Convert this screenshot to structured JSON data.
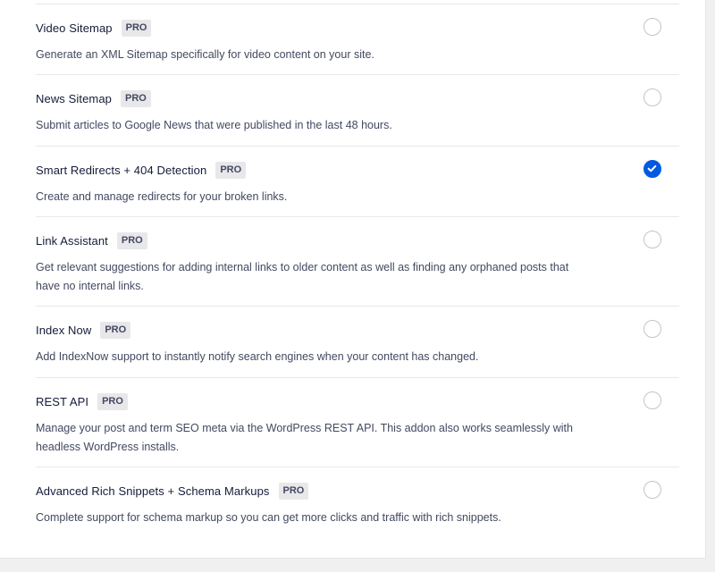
{
  "addons": [
    {
      "name": "Video Sitemap",
      "badge": "PRO",
      "description": "Generate an XML Sitemap specifically for video content on your site.",
      "enabled": false
    },
    {
      "name": "News Sitemap",
      "badge": "PRO",
      "description": "Submit articles to Google News that were published in the last 48 hours.",
      "enabled": false
    },
    {
      "name": "Smart Redirects + 404 Detection",
      "badge": "PRO",
      "description": "Create and manage redirects for your broken links.",
      "enabled": true
    },
    {
      "name": "Link Assistant",
      "badge": "PRO",
      "description": "Get relevant suggestions for adding internal links to older content as well as finding any orphaned posts that have no internal links.",
      "enabled": false
    },
    {
      "name": "Index Now",
      "badge": "PRO",
      "description": "Add IndexNow support to instantly notify search engines when your content has changed.",
      "enabled": false
    },
    {
      "name": "REST API",
      "badge": "PRO",
      "description": "Manage your post and term SEO meta via the WordPress REST API. This addon also works seamlessly with headless WordPress installs.",
      "enabled": false
    },
    {
      "name": "Advanced Rich Snippets + Schema Markups",
      "badge": "PRO",
      "description": "Complete support for schema markup so you can get more clicks and traffic with rich snippets.",
      "enabled": false
    }
  ],
  "colors": {
    "accent": "#005ae0",
    "badge_bg": "#e8e8eb"
  }
}
